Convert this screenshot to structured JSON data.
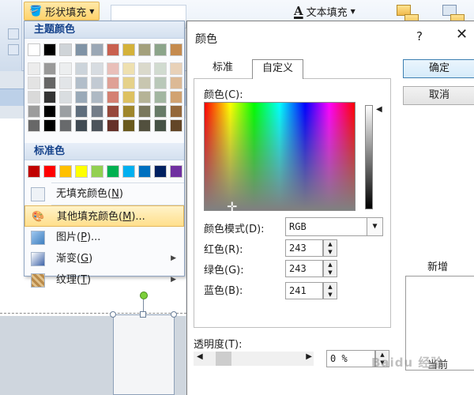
{
  "ribbon": {
    "shape_fill_label": "形状填充",
    "text_fill_label": "文本填充",
    "text_fill_icon": "A"
  },
  "fill_menu": {
    "theme_header": "主题颜色",
    "standard_header": "标准色",
    "theme_colors_top": [
      "#ffffff",
      "#000000",
      "#eeece1",
      "#1f497d",
      "#4f81bd",
      "#c0504d",
      "#9bbb59",
      "#8064a2",
      "#4bacc6",
      "#f79646"
    ],
    "theme_colors_top_display": [
      "#ffffff",
      "#000000",
      "#cfd4d8",
      "#7f93a6",
      "#9aa7b5",
      "#c9604f",
      "#d4b23a",
      "#a3a07c",
      "#8ba48a",
      "#c58b4e"
    ],
    "standard_colors": [
      "#c00000",
      "#ff0000",
      "#ffc000",
      "#ffff00",
      "#92d050",
      "#00b050",
      "#00b0f0",
      "#0070c0",
      "#002060",
      "#7030a0"
    ],
    "items": [
      {
        "label": "无填充颜色",
        "key": "N",
        "icon": "no-fill-icon",
        "submenu": false
      },
      {
        "label": "其他填充颜色",
        "key": "M",
        "suffix": "...",
        "icon": "palette-icon",
        "submenu": false,
        "highlighted": true
      },
      {
        "label": "图片",
        "key": "P",
        "suffix": "...",
        "icon": "picture-icon",
        "submenu": false
      },
      {
        "label": "渐变",
        "key": "G",
        "icon": "gradient-icon",
        "submenu": true
      },
      {
        "label": "纹理",
        "key": "T",
        "icon": "texture-icon",
        "submenu": true
      }
    ]
  },
  "dialog": {
    "title": "颜色",
    "help": "?",
    "close": "✕",
    "tabs": [
      "标准",
      "自定义"
    ],
    "active_tab": "自定义",
    "ok_label": "确定",
    "cancel_label": "取消",
    "colors_label": "颜色(C):",
    "mode_label": "颜色模式(D):",
    "mode_value": "RGB",
    "red_label": "红色(R):",
    "green_label": "绿色(G):",
    "blue_label": "蓝色(B):",
    "red_value": "243",
    "green_value": "243",
    "blue_value": "241",
    "new_label": "新增",
    "current_label": "当前",
    "transparency_label": "透明度(T):",
    "transparency_value": "0 %"
  },
  "watermark": "Baidu 经验"
}
